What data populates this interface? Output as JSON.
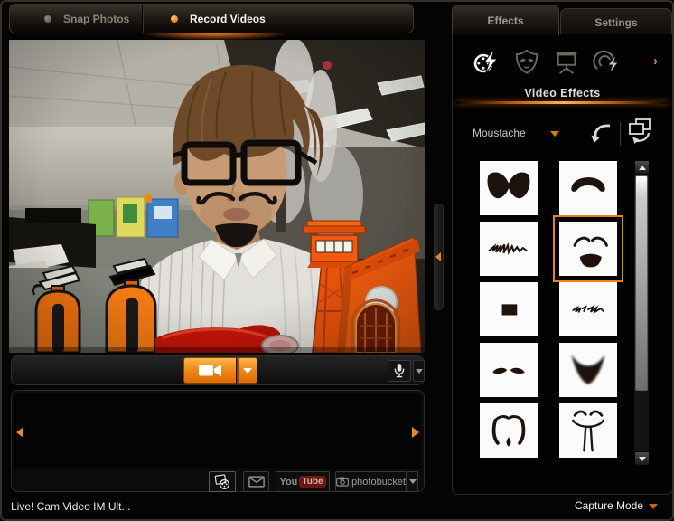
{
  "colors": {
    "accent": "#f08a1c",
    "selected_border": "#e8821a",
    "record_button": "#f08a1c"
  },
  "left_tabs": {
    "items": [
      {
        "label": "Snap Photos",
        "active": false
      },
      {
        "label": "Record Videos",
        "active": true
      }
    ]
  },
  "right_panel": {
    "tabs": [
      {
        "label": "Effects",
        "active": true
      },
      {
        "label": "Settings",
        "active": false
      }
    ],
    "categories": [
      {
        "icon": "film-effects-icon",
        "active": true
      },
      {
        "icon": "mask-effects-icon",
        "active": false
      },
      {
        "icon": "background-effects-icon",
        "active": false
      },
      {
        "icon": "distortion-effects-icon",
        "active": false
      }
    ],
    "more_arrow": "›",
    "section_title": "Video Effects",
    "style_dropdown": {
      "value": "Moustache"
    },
    "thumbnails": [
      {
        "style": "handlebar",
        "selected": false
      },
      {
        "style": "round-droop",
        "selected": false
      },
      {
        "style": "thin-scribble",
        "selected": false
      },
      {
        "style": "curl-and-goatee",
        "selected": true
      },
      {
        "style": "toothbrush",
        "selected": false
      },
      {
        "style": "small-scribble",
        "selected": false
      },
      {
        "style": "thin-pair",
        "selected": false
      },
      {
        "style": "bushy-goatee",
        "selected": false
      },
      {
        "style": "fu-manchu",
        "selected": false
      },
      {
        "style": "long-strands",
        "selected": false
      }
    ]
  },
  "share_bar": {
    "youtube_part1": "You",
    "youtube_part2": "Tube",
    "photobucket_label": "photobucket"
  },
  "status_bar": {
    "app_title": "Live! Cam Video IM Ult...",
    "mode_label": "Capture Mode"
  }
}
